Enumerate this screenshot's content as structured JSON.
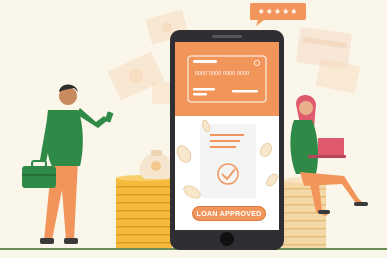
{
  "loan_status": {
    "label": "LOAN APPROVED"
  },
  "card": {
    "number": "0000 0000 0000 0000"
  },
  "rating": {
    "stars": "★★★★★",
    "value": 5
  },
  "colors": {
    "background": "#fbf6ea",
    "accent": "#f2955a",
    "phone": "#2f2f33",
    "coins": "#f5b93c",
    "person_shirt": "#2f8a47",
    "ground": "#6a8f53"
  },
  "icons": [
    "coin-stack-icon",
    "money-bag-icon",
    "credit-card-icon",
    "document-icon",
    "checkmark-icon",
    "laptop-icon",
    "briefcase-icon",
    "star-rating-icon"
  ]
}
